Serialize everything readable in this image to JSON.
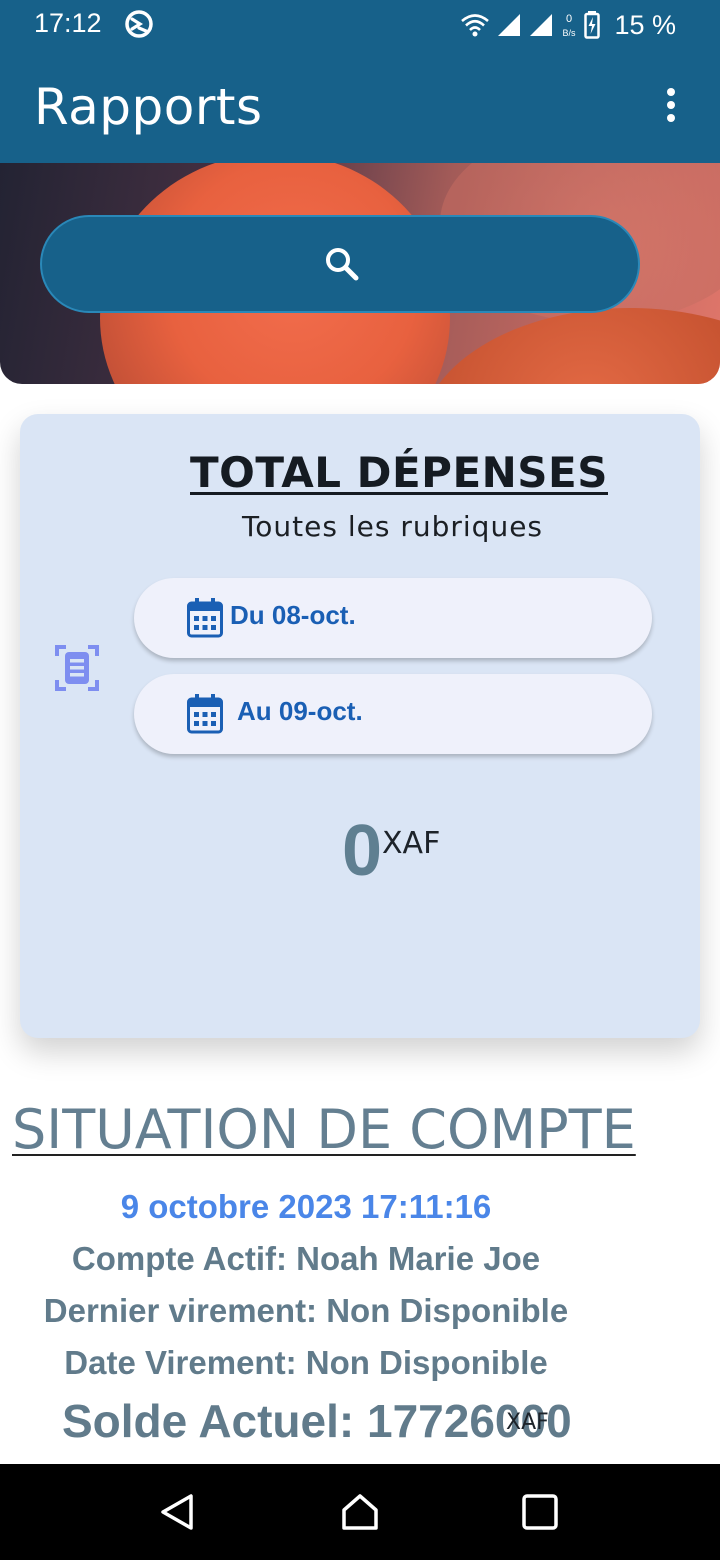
{
  "status_bar": {
    "time": "17:12",
    "battery": "15 %",
    "network_speed": "0 B/s",
    "icons": [
      "app-notification-icon",
      "wifi-icon",
      "signal-icon",
      "signal-icon",
      "battery-charging-icon"
    ]
  },
  "app_bar": {
    "title": "Rapports",
    "menu_icon": "more-vert-icon",
    "color": "#17618a"
  },
  "search": {
    "icon": "search-icon"
  },
  "expenses_card": {
    "title": "TOTAL DÉPENSES",
    "subtitle": "Toutes les rubriques",
    "from_label": "Du 08-oct.",
    "to_label": "Au 09-oct.",
    "amount": "0",
    "currency": "XAF",
    "background": "#dae5f5"
  },
  "situation": {
    "title": "SITUATION DE COMPTE",
    "date": "9 octobre 2023 17:11:16",
    "account": "Compte Actif: Noah Marie Joe",
    "last_transfer": "Dernier virement: Non Disponible",
    "transfer_date": "Date Virement: Non Disponible",
    "balance": "Solde Actuel: 17726000",
    "balance_currency": "XAF"
  },
  "nav_bar": {
    "buttons": [
      "back-icon",
      "home-icon",
      "recent-apps-icon"
    ]
  }
}
